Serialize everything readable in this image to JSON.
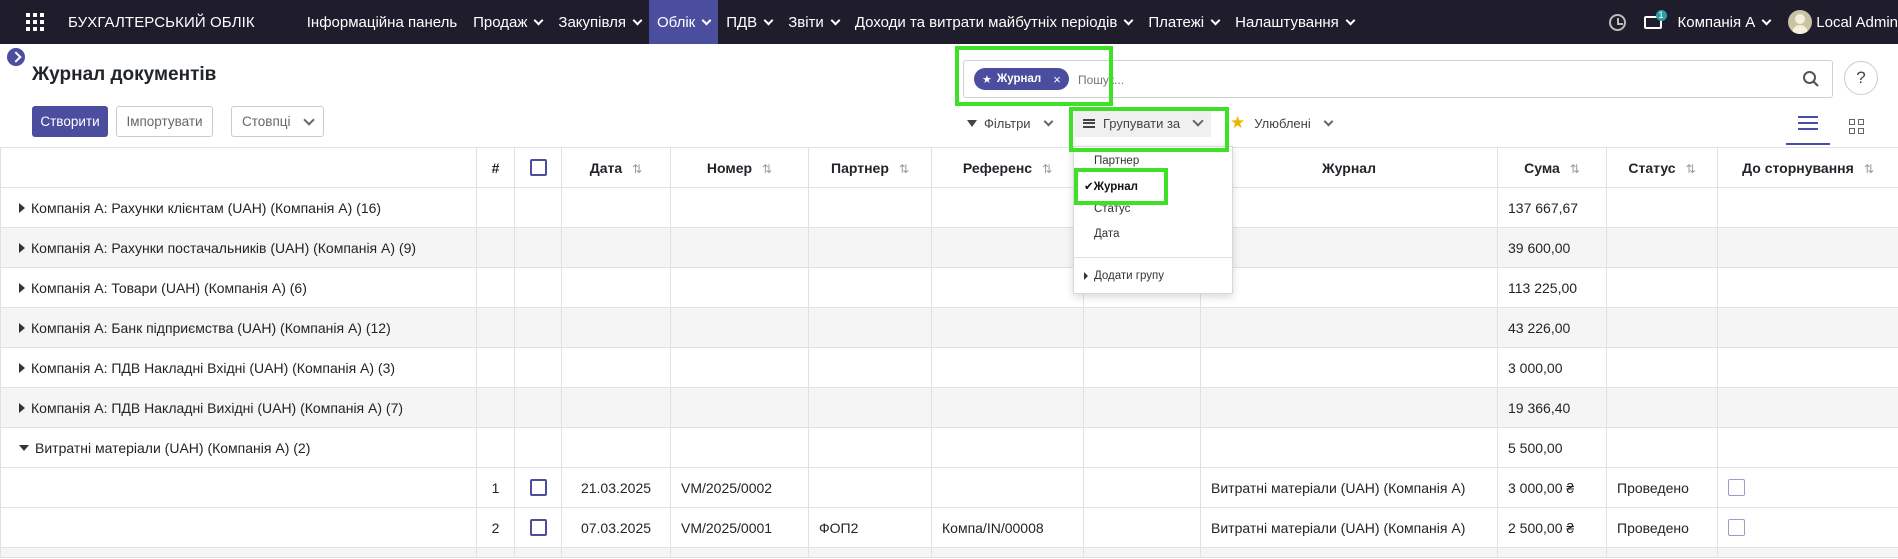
{
  "navbar": {
    "brand": "БУХГАЛТЕРСЬКИЙ ОБЛІК",
    "menu": [
      {
        "label": "Інформаційна панель",
        "caret": false,
        "active": false
      },
      {
        "label": "Продаж",
        "caret": true,
        "active": false
      },
      {
        "label": "Закупівля",
        "caret": true,
        "active": false
      },
      {
        "label": "Облік",
        "caret": true,
        "active": true
      },
      {
        "label": "ПДВ",
        "caret": true,
        "active": false
      },
      {
        "label": "Звіти",
        "caret": true,
        "active": false
      },
      {
        "label": "Доходи та витрати майбутніх періодів",
        "caret": true,
        "active": false
      },
      {
        "label": "Платежі",
        "caret": true,
        "active": false
      },
      {
        "label": "Налаштування",
        "caret": true,
        "active": false
      }
    ],
    "chat_badge": "1",
    "company": "Компанія A",
    "user": "Local Admin"
  },
  "control": {
    "title": "Журнал документів",
    "create_label": "Створити",
    "import_label": "Імпортувати",
    "columns_label": "Стовпці",
    "facet_label": "Журнал",
    "facet_remove": "×",
    "search_placeholder": "Пошук...",
    "help_label": "?",
    "filters_label": "Фільтри",
    "groupby_label": "Групувати за",
    "favorites_label": "Улюблені"
  },
  "groupby_menu": {
    "items": [
      "Партнер",
      "Журнал",
      "Статус",
      "Дата"
    ],
    "selected": "Журнал",
    "add_label": "Додати групу"
  },
  "table": {
    "headers": {
      "num": "#",
      "date": "Дата",
      "number": "Номер",
      "partner": "Партнер",
      "reference": "Референс",
      "journal": "Журнал",
      "amount": "Сума",
      "status": "Статус",
      "reversal": "До сторнування"
    },
    "groups": [
      {
        "label": "Компанія A: Рахунки клієнтам (UAH) (Компанія A) (16)",
        "amount": "137 667,67",
        "expanded": false
      },
      {
        "label": "Компанія A: Рахунки постачальників (UAH) (Компанія A) (9)",
        "amount": "39 600,00",
        "expanded": false
      },
      {
        "label": "Компанія A: Товари (UAH) (Компанія A) (6)",
        "amount": "113 225,00",
        "expanded": false
      },
      {
        "label": "Компанія A: Банк підприємства (UAH) (Компанія A) (12)",
        "amount": "43 226,00",
        "expanded": false
      },
      {
        "label": "Компанія A: ПДВ Накладні Вхідні (UAH) (Компанія A) (3)",
        "amount": "3 000,00",
        "expanded": false
      },
      {
        "label": "Компанія A: ПДВ Накладні Вихідні (UAH) (Компанія A) (7)",
        "amount": "19 366,40",
        "expanded": false
      },
      {
        "label": "Витратні матеріали (UAH) (Компанія A) (2)",
        "amount": "5 500,00",
        "expanded": true
      }
    ],
    "rows": [
      {
        "num": "1",
        "date": "21.03.2025",
        "number": "VM/2025/0002",
        "partner": "",
        "reference": "",
        "journal": "Витратні матеріали (UAH) (Компанія A)",
        "amount": "3 000,00 ₴",
        "status": "Проведено"
      },
      {
        "num": "2",
        "date": "07.03.2025",
        "number": "VM/2025/0001",
        "partner": "ФОП2",
        "reference": "Компа/IN/00008",
        "journal": "Витратні матеріали (UAH) (Компанія A)",
        "amount": "2 500,00 ₴",
        "status": "Проведено"
      }
    ]
  },
  "colors": {
    "navbar_bg": "#1f1d2b",
    "primary": "#4b4e9e",
    "highlight": "#3fe028",
    "favorite_star": "#f0b400"
  }
}
